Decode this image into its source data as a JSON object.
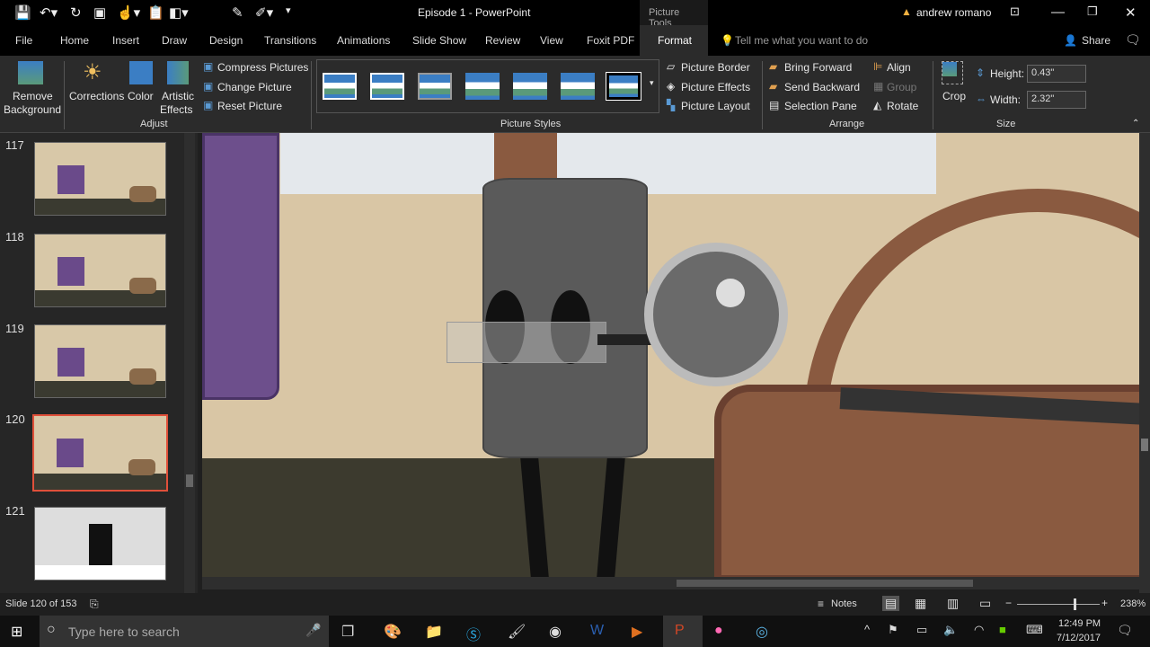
{
  "window": {
    "title": "Episode 1  -  PowerPoint",
    "context_tab": "Picture Tools",
    "user": "andrew romano"
  },
  "tabs": [
    "File",
    "Home",
    "Insert",
    "Draw",
    "Design",
    "Transitions",
    "Animations",
    "Slide Show",
    "Review",
    "View",
    "Foxit PDF",
    "Format"
  ],
  "tell_me": "Tell me what you want to do",
  "share": "Share",
  "ribbon": {
    "remove_bg_1": "Remove",
    "remove_bg_2": "Background",
    "corrections": "Corrections",
    "color": "Color",
    "artistic_1": "Artistic",
    "artistic_2": "Effects",
    "compress": "Compress Pictures",
    "change": "Change Picture",
    "reset": "Reset Picture",
    "adjust": "Adjust",
    "picture_styles": "Picture Styles",
    "border": "Picture Border",
    "effects": "Picture Effects",
    "layout": "Picture Layout",
    "bring_forward": "Bring Forward",
    "send_backward": "Send Backward",
    "selection_pane": "Selection Pane",
    "align": "Align",
    "group": "Group",
    "rotate": "Rotate",
    "arrange": "Arrange",
    "crop": "Crop",
    "height_label": "Height:",
    "height": "0.43\"",
    "width_label": "Width:",
    "width": "2.32\"",
    "size": "Size"
  },
  "slides": [
    "117",
    "118",
    "119",
    "120",
    "121"
  ],
  "selected_slide": "120",
  "status": {
    "slide": "Slide 120 of 153",
    "notes": "Notes",
    "zoom": "238%"
  },
  "taskbar": {
    "search": "Type here to search",
    "time": "12:49 PM",
    "date": "7/12/2017"
  }
}
